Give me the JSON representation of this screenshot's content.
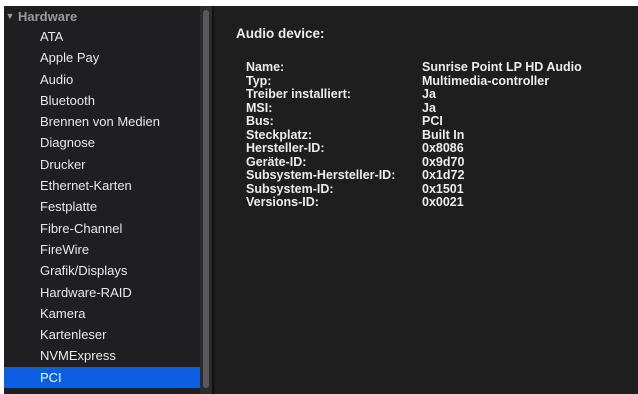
{
  "sidebar": {
    "group_label": "Hardware",
    "items": [
      {
        "label": "ATA"
      },
      {
        "label": "Apple Pay"
      },
      {
        "label": "Audio"
      },
      {
        "label": "Bluetooth"
      },
      {
        "label": "Brennen von Medien"
      },
      {
        "label": "Diagnose"
      },
      {
        "label": "Drucker"
      },
      {
        "label": "Ethernet-Karten"
      },
      {
        "label": "Festplatte"
      },
      {
        "label": "Fibre-Channel"
      },
      {
        "label": "FireWire"
      },
      {
        "label": "Grafik/Displays"
      },
      {
        "label": "Hardware-RAID"
      },
      {
        "label": "Kamera"
      },
      {
        "label": "Kartenleser"
      },
      {
        "label": "NVMExpress"
      },
      {
        "label": "PCI"
      }
    ],
    "selected": "PCI"
  },
  "detail": {
    "title": "Audio device:",
    "properties": [
      {
        "key": "Name:",
        "value": "Sunrise Point LP HD Audio"
      },
      {
        "key": "Typ:",
        "value": "Multimedia-controller"
      },
      {
        "key": "Treiber installiert:",
        "value": "Ja"
      },
      {
        "key": "MSI:",
        "value": "Ja"
      },
      {
        "key": "Bus:",
        "value": "PCI"
      },
      {
        "key": "Steckplatz:",
        "value": "Built In"
      },
      {
        "key": "Hersteller-ID:",
        "value": "0x8086"
      },
      {
        "key": "Geräte-ID:",
        "value": "0x9d70"
      },
      {
        "key": "Subsystem-Hersteller-ID:",
        "value": "0x1d72"
      },
      {
        "key": "Subsystem-ID:",
        "value": "0x1501"
      },
      {
        "key": "Versions-ID:",
        "value": "0x0021"
      }
    ]
  },
  "colors": {
    "sidebar_bg": "#1f1f21",
    "detail_bg": "#1e1e1e",
    "selection": "#0b5fe0",
    "text": "#ececee",
    "group_header": "#9a9a9e"
  },
  "icons": {
    "disclosure": "disclosure-triangle-expanded-icon"
  }
}
